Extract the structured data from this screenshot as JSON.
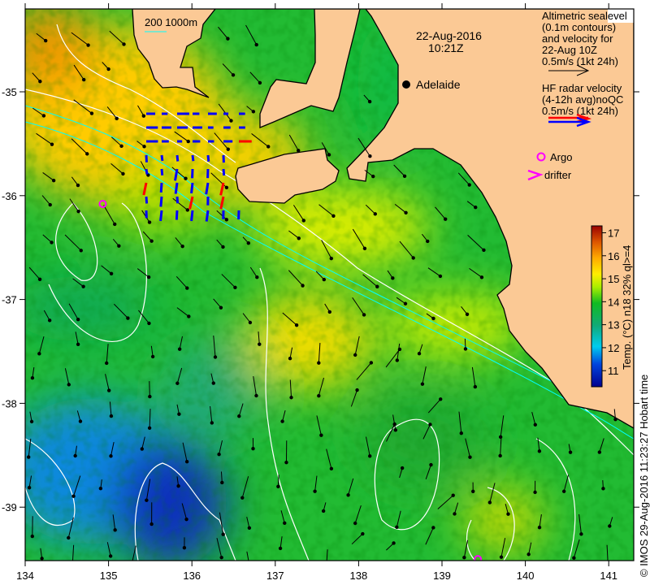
{
  "title": {
    "date": "22-Aug-2016",
    "time": "10:21Z"
  },
  "scale_note": {
    "label": "200  1000m"
  },
  "place": {
    "adelaide": "Adelaide"
  },
  "legend": {
    "altimetry": [
      "Altimetric sealevel",
      "(0.1m contours)",
      "and velocity for",
      "22-Aug 10Z",
      "0.5m/s (1kt 24h)"
    ],
    "hf_radar": [
      "HF radar velocity",
      "(4-12h avg)noQC",
      "0.5m/s (1kt 24h)"
    ],
    "argo": "Argo",
    "drifter": "drifter"
  },
  "colorbar": {
    "label": "Temp. (°C) n18 32% ql>=4",
    "ticks": [
      "11",
      "12",
      "13",
      "14",
      "15",
      "16",
      "17"
    ],
    "range": [
      10.3,
      17.3
    ]
  },
  "axes": {
    "lon_ticks": [
      "134",
      "135",
      "136",
      "137",
      "138",
      "139",
      "140",
      "141"
    ],
    "lat_ticks": [
      "-35",
      "-36",
      "-37",
      "-38",
      "-39"
    ]
  },
  "argo_floats": [
    {
      "lon": 134.93,
      "lat": -36.08
    },
    {
      "lon": 139.43,
      "lat": -39.5
    }
  ],
  "credit": "© IMOS 29-Aug-2016 11:23:27 Hobart time",
  "colors": {
    "land": "#fbc995",
    "radar_blue": "#0000ff",
    "radar_red": "#ff0000",
    "argo": "#ff00ff"
  }
}
